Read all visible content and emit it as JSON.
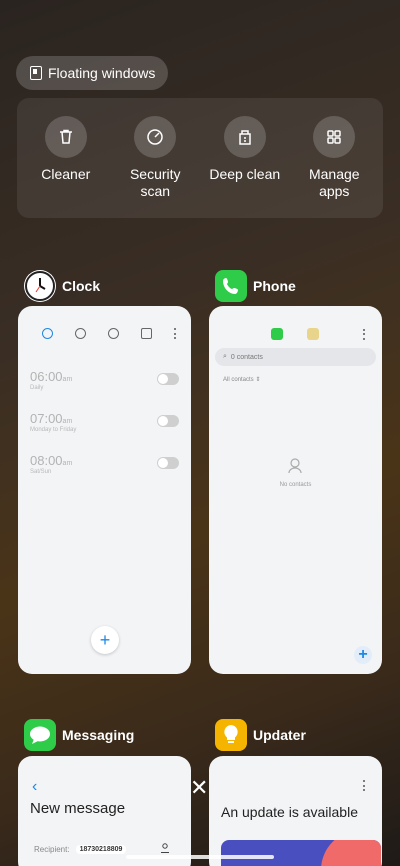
{
  "floating_windows": {
    "label": "Floating windows"
  },
  "tools": [
    {
      "label": "Cleaner",
      "icon": "trash-icon"
    },
    {
      "label": "Security\nscan",
      "icon": "security-scan-icon"
    },
    {
      "label": "Deep clean",
      "icon": "deep-clean-icon"
    },
    {
      "label": "Manage\napps",
      "icon": "grid-icon"
    }
  ],
  "apps": {
    "clock": {
      "name": "Clock",
      "alarms": [
        {
          "time": "06:00",
          "ampm": "am",
          "repeat": "Daily"
        },
        {
          "time": "07:00",
          "ampm": "am",
          "repeat": "Monday to Friday"
        },
        {
          "time": "08:00",
          "ampm": "am",
          "repeat": "Sat/Sun"
        }
      ]
    },
    "phone": {
      "name": "Phone",
      "search_placeholder": "0 contacts",
      "filter": "All contacts",
      "empty": "No contacts"
    },
    "messaging": {
      "name": "Messaging",
      "title": "New message",
      "recipient_label": "Recipient:",
      "recipient_value": "18730218809"
    },
    "updater": {
      "name": "Updater",
      "title": "An update is available"
    }
  },
  "colors": {
    "accent": "#1e88e5",
    "phone_green": "#2ecc48",
    "messaging_green": "#2ecc48",
    "updater_yellow": "#f5b400"
  }
}
